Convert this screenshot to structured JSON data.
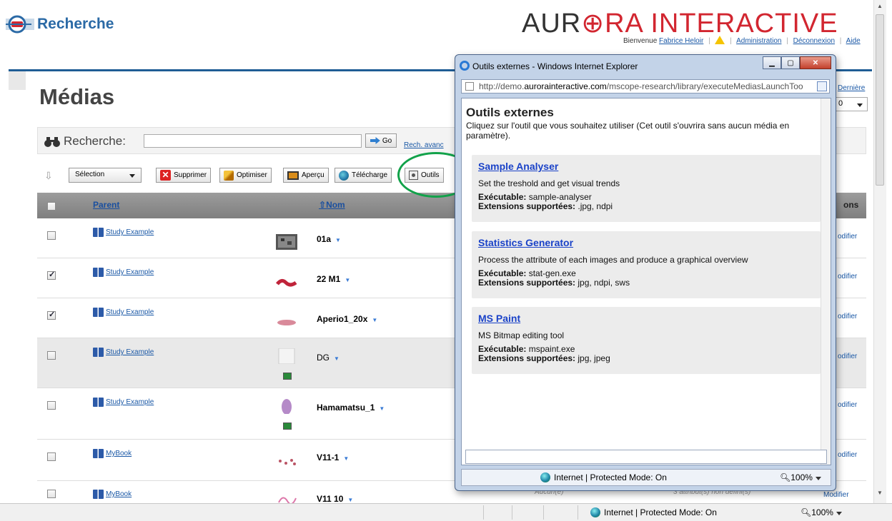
{
  "app": {
    "title": "Recherche",
    "brand_left": "AUR",
    "brand_mid": "⊕",
    "brand_right": "RA INTERACTIVE"
  },
  "user_bar": {
    "welcome": "Bienvenue",
    "user": "Fabrice Heloir",
    "admin": "Administration",
    "logout": "Déconnexion",
    "help": "Aide"
  },
  "page_title": "Médias",
  "search": {
    "label": "Recherche:",
    "value": "",
    "go": "Go",
    "advanced": "Rech. avanc"
  },
  "toolbar": {
    "selection": "Sélection",
    "delete": "Supprimer",
    "optimize": "Optimiser",
    "preview": "Aperçu",
    "download": "Télécharge",
    "tools": "Outils"
  },
  "grid": {
    "col_parent": "Parent",
    "col_name": "Nom",
    "col_actions": "ons",
    "rows": [
      {
        "checked": false,
        "parent": "Study Example",
        "name": "01a",
        "modify": "odifier"
      },
      {
        "checked": true,
        "parent": "Study Example",
        "name": "22 M1",
        "modify": "odifier"
      },
      {
        "checked": true,
        "parent": "Study Example",
        "name": "Aperio1_20x",
        "modify": "odifier"
      },
      {
        "checked": false,
        "parent": "Study Example",
        "name": "DG",
        "modify": "odifier"
      },
      {
        "checked": false,
        "parent": "Study Example",
        "name": "Hamamatsu_1",
        "modify": "odifier"
      },
      {
        "checked": false,
        "parent": "MyBook",
        "name": "V11-1",
        "modify": "odifier"
      },
      {
        "checked": false,
        "parent": "MyBook",
        "name": "V11 10",
        "modify": "Modifier",
        "ghost1": "Aucun(e)",
        "ghost2": "3 attribut(s) non défini(s)"
      }
    ]
  },
  "right_panel": {
    "last": "Dernière",
    "page": "0"
  },
  "popup": {
    "window_title": "Outils externes - Windows Internet Explorer",
    "url_pre": "http://demo.",
    "url_host": "aurorainteractive.com",
    "url_post": "/mscope-research/library/executeMediasLaunchToo",
    "heading": "Outils externes",
    "description": "Cliquez sur l'outil que vous souhaitez utiliser (Cet outil s'ouvrira sans aucun média en paramètre).",
    "exe_label": "Exécutable:",
    "ext_label": "Extensions supportées:",
    "tools": [
      {
        "name": "Sample Analyser",
        "desc": "Set the treshold and get visual trends",
        "exe": "sample-analyser",
        "ext": ".jpg, ndpi"
      },
      {
        "name": "Statistics Generator",
        "desc": "Process the attribute of each images and produce a graphical overview",
        "exe": "stat-gen.exe",
        "ext": "jpg, ndpi, sws"
      },
      {
        "name": "MS Paint",
        "desc": "MS Bitmap editing tool",
        "exe": "mspaint.exe",
        "ext": "jpg, jpeg"
      }
    ],
    "status_zone": "Internet | Protected Mode: On",
    "zoom": "100%"
  },
  "statusbar": {
    "zone": "Internet | Protected Mode: On",
    "zoom": "100%"
  },
  "colors": {
    "accent": "#2b6aa6",
    "brand_red": "#d22630",
    "highlight": "#12a24a"
  }
}
